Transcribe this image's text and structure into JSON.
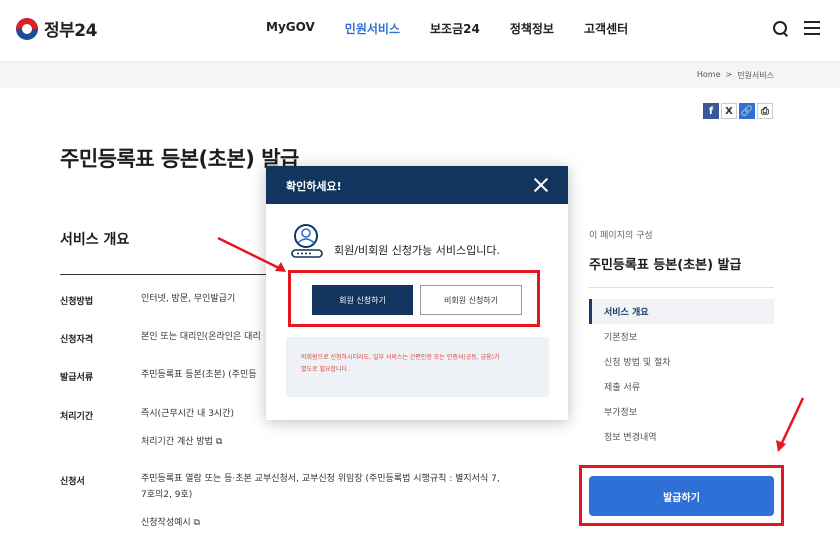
{
  "header": {
    "logo_text": "정부24",
    "nav": [
      "MyGOV",
      "민원서비스",
      "보조금24",
      "정책정보",
      "고객센터"
    ],
    "nav_active_index": 1,
    "search_icon": "search-icon",
    "menu_icon": "hamburger-menu-icon"
  },
  "breadcrumb": {
    "home": "Home",
    "sep": ">",
    "current": "민원서비스"
  },
  "share": {
    "facebook": "f",
    "x": "X",
    "link": "🔗",
    "print": "⎙"
  },
  "page": {
    "title": "주민등록표 등본(초본) 발급"
  },
  "overview": {
    "section_title": "서비스 개요",
    "rows": [
      {
        "label": "신청방법",
        "value": "인터넷, 방문, 무인발급기"
      },
      {
        "label": "신청자격",
        "value": "본인 또는 대리인(온라인은 대리"
      },
      {
        "label": "발급서류",
        "value": "주민등록표 등본(초본) (주민등"
      },
      {
        "label": "처리기간",
        "value": "즉시(근무시간 내 3시간)",
        "link": "처리기간 계산 방법 ⧉"
      },
      {
        "label": "신청서",
        "value": "주민등록표 열람 또는 등·초본 교부신청서, 교부신청 위임장 (주민등록법 시행규칙 : 별지서식 7,",
        "value2": "7호의2, 9호)",
        "link": "신청작성예시 ⧉"
      }
    ]
  },
  "toc": {
    "caption": "이 페이지의 구성",
    "title": "주민등록표 등본(초본) 발급",
    "items": [
      "서비스 개요",
      "기본정보",
      "신청 방법 및 절차",
      "제출 서류",
      "부가정보",
      "정보 변경내역"
    ],
    "active_index": 0,
    "apply_label": "발급하기"
  },
  "modal": {
    "title": "확인하세요!",
    "message": "회원/비회원 신청가능 서비스입니다.",
    "member_button": "회원 신청하기",
    "guest_button": "비회원 신청하기",
    "notice_line1": "비회원으로 신청하시더라도, 일부 서비스는 간편인증 또는 인증서(공동, 금융)가",
    "notice_line2": "별도로 필요합니다."
  },
  "colors": {
    "brand_blue": "#2e6fd8",
    "modal_navy": "#11355f",
    "highlight_red": "#e4161e",
    "notice_red": "#d84a3b"
  }
}
